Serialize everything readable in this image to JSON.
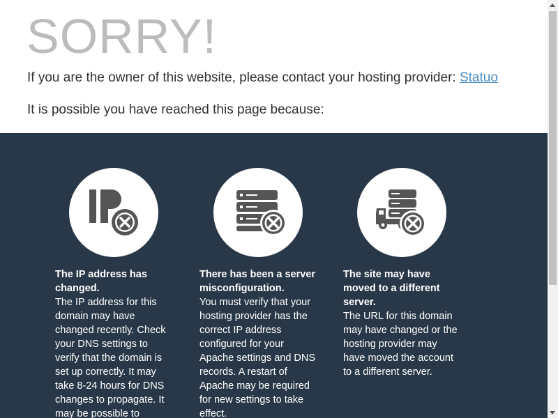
{
  "header": {
    "title": "SORRY!",
    "owner_text": "If you are the owner of this website, please contact your hosting provider: ",
    "provider_link": "Statuo",
    "reason_intro": "It is possible you have reached this page because:"
  },
  "reasons": [
    {
      "icon": "ip-address-error-icon",
      "title": "The IP address has changed.",
      "text": "The IP address for this domain may have changed recently. Check your DNS settings to verify that the domain is set up correctly. It may take 8-24 hours for DNS changes to propagate. It may be possible to restore access"
    },
    {
      "icon": "server-error-icon",
      "title": "There has been a server misconfiguration.",
      "text": "You must verify that your hosting provider has the correct IP address configured for your Apache settings and DNS records. A restart of Apache may be required for new settings to take effect."
    },
    {
      "icon": "server-moved-icon",
      "title": "The site may have moved to a different server.",
      "text": "The URL for this domain may have changed or the hosting provider may have moved the account to a different server."
    }
  ],
  "colors": {
    "title_gray": "#bcbcbc",
    "link_blue": "#4a8bc2",
    "panel_bg": "#283848",
    "icon_gray": "#555555"
  }
}
